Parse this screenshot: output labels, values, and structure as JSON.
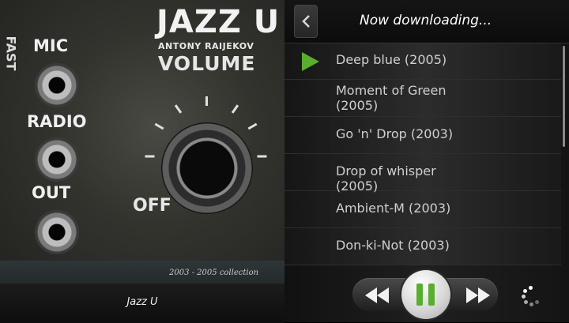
{
  "album": {
    "cover_title": "JAZZ U",
    "cover_artist": "ANTONY RAIJEKOV",
    "cover_volume": "VOLUME",
    "cover_labels": [
      "MIC",
      "RADIO",
      "OUT"
    ],
    "cover_off": "OFF",
    "cover_fast": "FAST",
    "cover_collection": "2003 - 2005 collection",
    "name": "Jazz U"
  },
  "header": {
    "status": "Now downloading..."
  },
  "tracks": [
    {
      "title": "Deep blue (2005)",
      "playing": true
    },
    {
      "title": "Moment of Green (2005)",
      "playing": false
    },
    {
      "title": "Go 'n' Drop (2003)",
      "playing": false
    },
    {
      "title": "Drop of whisper (2005)",
      "playing": false
    },
    {
      "title": "Ambient-M (2003)",
      "playing": false
    },
    {
      "title": "Don-ki-Not (2003)",
      "playing": false
    }
  ],
  "icons": {
    "back": "chevron-left-icon",
    "rewind": "rewind-icon",
    "pause": "pause-icon",
    "fast_forward": "fast-forward-icon",
    "loading": "loading-spinner-icon",
    "now_playing": "play-indicator-icon"
  },
  "colors": {
    "accent_green": "#5aae2f"
  }
}
